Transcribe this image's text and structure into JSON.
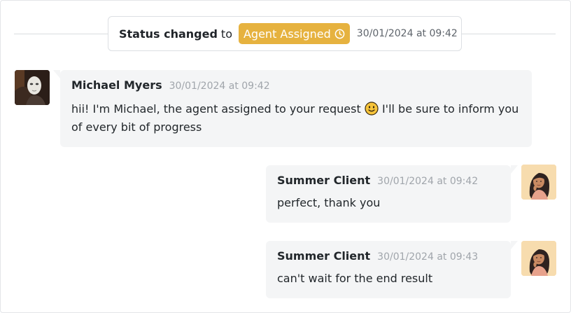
{
  "status_event": {
    "prefix_bold": "Status changed",
    "prefix_to": "to",
    "status_label": "Agent Assigned",
    "status_color": "#e6b23f",
    "status_icon": "clock-icon",
    "timestamp": "30/01/2024 at 09:42"
  },
  "messages": [
    {
      "author": "Michael Myers",
      "timestamp": "30/01/2024 at 09:42",
      "text_before_emoji": "hii! I'm Michael, the agent assigned to your request",
      "emoji": "slightly-smiling-face-emoji",
      "text_after_emoji": " I'll be sure to inform you of every bit of progress",
      "side": "left"
    },
    {
      "author": "Summer Client",
      "timestamp": "30/01/2024 at 09:42",
      "text": "perfect, thank you",
      "side": "right"
    },
    {
      "author": "Summer Client",
      "timestamp": "30/01/2024 at 09:43",
      "text": "can't wait for the end result",
      "side": "right"
    }
  ]
}
